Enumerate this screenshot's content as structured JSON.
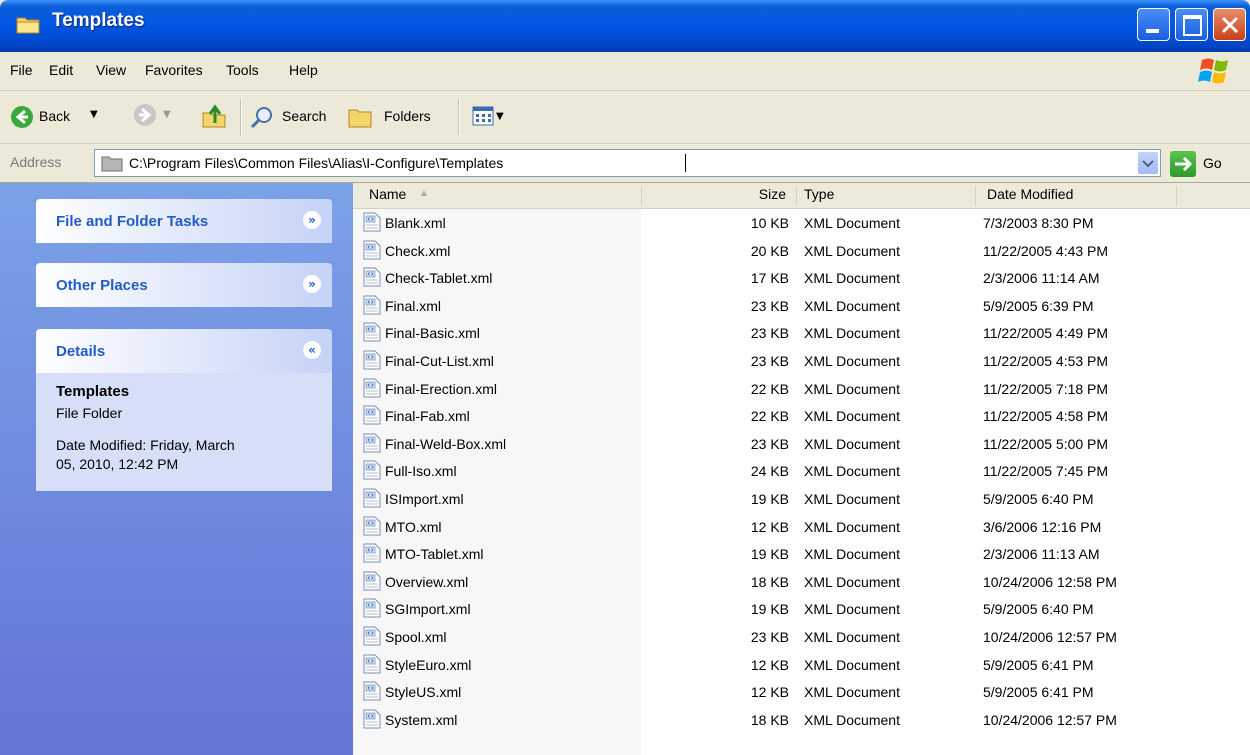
{
  "window": {
    "title": "Templates"
  },
  "menu": [
    "File",
    "Edit",
    "View",
    "Favorites",
    "Tools",
    "Help"
  ],
  "toolbar": {
    "back": "Back",
    "search": "Search",
    "folders": "Folders"
  },
  "address": {
    "label": "Address",
    "path": "C:\\Program Files\\Common Files\\Alias\\I-Configure\\Templates",
    "go": "Go"
  },
  "sidebar": {
    "file_tasks": "File and Folder Tasks",
    "other_places": "Other Places",
    "details": "Details",
    "details_name": "Templates",
    "details_type": "File Folder",
    "details_date1": "Date Modified: Friday, March",
    "details_date2": "05, 2010, 12:42 PM"
  },
  "columns": {
    "name": "Name",
    "size": "Size",
    "type": "Type",
    "date": "Date Modified"
  },
  "files": [
    {
      "name": "Blank.xml",
      "size": "10 KB",
      "type": "XML Document",
      "date": "7/3/2003 8:30 PM"
    },
    {
      "name": "Check.xml",
      "size": "20 KB",
      "type": "XML Document",
      "date": "11/22/2005 4:43 PM"
    },
    {
      "name": "Check-Tablet.xml",
      "size": "17 KB",
      "type": "XML Document",
      "date": "2/3/2006 11:14 AM"
    },
    {
      "name": "Final.xml",
      "size": "23 KB",
      "type": "XML Document",
      "date": "5/9/2005 6:39 PM"
    },
    {
      "name": "Final-Basic.xml",
      "size": "23 KB",
      "type": "XML Document",
      "date": "11/22/2005 4:49 PM"
    },
    {
      "name": "Final-Cut-List.xml",
      "size": "23 KB",
      "type": "XML Document",
      "date": "11/22/2005 4:53 PM"
    },
    {
      "name": "Final-Erection.xml",
      "size": "22 KB",
      "type": "XML Document",
      "date": "11/22/2005 7:18 PM"
    },
    {
      "name": "Final-Fab.xml",
      "size": "22 KB",
      "type": "XML Document",
      "date": "11/22/2005 4:58 PM"
    },
    {
      "name": "Final-Weld-Box.xml",
      "size": "23 KB",
      "type": "XML Document",
      "date": "11/22/2005 5:00 PM"
    },
    {
      "name": "Full-Iso.xml",
      "size": "24 KB",
      "type": "XML Document",
      "date": "11/22/2005 7:45 PM"
    },
    {
      "name": "ISImport.xml",
      "size": "19 KB",
      "type": "XML Document",
      "date": "5/9/2005 6:40 PM"
    },
    {
      "name": "MTO.xml",
      "size": "12 KB",
      "type": "XML Document",
      "date": "3/6/2006 12:16 PM"
    },
    {
      "name": "MTO-Tablet.xml",
      "size": "19 KB",
      "type": "XML Document",
      "date": "2/3/2006 11:13 AM"
    },
    {
      "name": "Overview.xml",
      "size": "18 KB",
      "type": "XML Document",
      "date": "10/24/2006 12:58 PM"
    },
    {
      "name": "SGImport.xml",
      "size": "19 KB",
      "type": "XML Document",
      "date": "5/9/2005 6:40 PM"
    },
    {
      "name": "Spool.xml",
      "size": "23 KB",
      "type": "XML Document",
      "date": "10/24/2006 12:57 PM"
    },
    {
      "name": "StyleEuro.xml",
      "size": "12 KB",
      "type": "XML Document",
      "date": "5/9/2005 6:41 PM"
    },
    {
      "name": "StyleUS.xml",
      "size": "12 KB",
      "type": "XML Document",
      "date": "5/9/2005 6:41 PM"
    },
    {
      "name": "System.xml",
      "size": "18 KB",
      "type": "XML Document",
      "date": "10/24/2006 12:57 PM"
    }
  ]
}
